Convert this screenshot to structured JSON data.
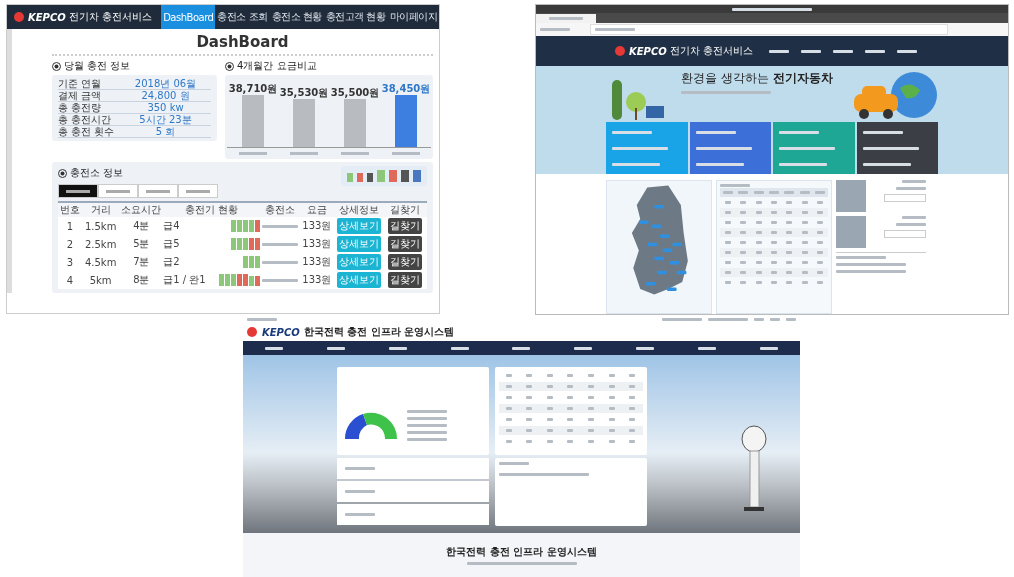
{
  "dashboard_screen": {
    "logo": "KEPCO",
    "service_name": "전기차 충전서비스",
    "nav": [
      {
        "label": "DashBoard",
        "selected": true
      },
      {
        "label": "충전소 조회",
        "selected": false
      },
      {
        "label": "충전소 현황",
        "selected": false
      },
      {
        "label": "충전고객 현황",
        "selected": false
      },
      {
        "label": "마이페이지",
        "selected": false
      }
    ],
    "title": "DashBoard",
    "monthly_info": {
      "title": "당월 충전 정보",
      "rows": [
        {
          "label": "기준 연월",
          "value": "2018년 06월"
        },
        {
          "label": "결제 금액",
          "value": "24,800 원"
        },
        {
          "label": "총 충전량",
          "value": "350 kw"
        },
        {
          "label": "총 충전시간",
          "value": "5시간 23분"
        },
        {
          "label": "총 충전 횟수",
          "value": "5 회"
        }
      ]
    },
    "fee_comparison": {
      "title": "4개월간 요금비교",
      "bars": [
        {
          "amount": "38,710원"
        },
        {
          "amount": "35,530원"
        },
        {
          "amount": "35,500원"
        },
        {
          "amount": "38,450원"
        }
      ]
    },
    "stations": {
      "title": "충전소 정보",
      "tabs": [
        {
          "selected": true
        },
        {
          "selected": false
        },
        {
          "selected": false
        },
        {
          "selected": false
        }
      ],
      "legend": [
        {
          "kind": "slow_available"
        },
        {
          "kind": "slow_in_use"
        },
        {
          "kind": "slow_offline"
        },
        {
          "kind": "fast_available"
        },
        {
          "kind": "fast_in_use"
        },
        {
          "kind": "fast_offline"
        },
        {
          "kind": "reserved"
        }
      ],
      "columns": [
        "번호",
        "거리",
        "소요시간",
        "충전기 현황",
        "충전소",
        "요금",
        "상세정보",
        "길찾기"
      ],
      "rows": [
        {
          "no": "1",
          "distance": "1.5km",
          "time": "4분",
          "summary": "급4",
          "chargers": [
            {
              "kind": "fast_available"
            },
            {
              "kind": "fast_available"
            },
            {
              "kind": "fast_available"
            },
            {
              "kind": "fast_available"
            },
            {
              "kind": "fast_in_use"
            }
          ],
          "price": "133원",
          "detail_button": "상세보기",
          "route_button": "길찾기"
        },
        {
          "no": "2",
          "distance": "2.5km",
          "time": "5분",
          "summary": "급5",
          "chargers": [
            {
              "kind": "fast_available"
            },
            {
              "kind": "fast_available"
            },
            {
              "kind": "fast_available"
            },
            {
              "kind": "fast_in_use"
            },
            {
              "kind": "fast_in_use"
            }
          ],
          "price": "133원",
          "detail_button": "상세보기",
          "route_button": "길찾기"
        },
        {
          "no": "3",
          "distance": "4.5km",
          "time": "7분",
          "summary": "급2",
          "chargers": [
            {
              "kind": "fast_available"
            },
            {
              "kind": "fast_available"
            },
            {
              "kind": "fast_available"
            }
          ],
          "price": "133원",
          "detail_button": "상세보기",
          "route_button": "길찾기"
        },
        {
          "no": "4",
          "distance": "5km",
          "time": "8분",
          "summary": "급1 / 완1",
          "chargers": [
            {
              "kind": "fast_available"
            },
            {
              "kind": "fast_available"
            },
            {
              "kind": "fast_available"
            },
            {
              "kind": "fast_in_use"
            },
            {
              "kind": "fast_in_use"
            },
            {
              "kind": "slow_available"
            },
            {
              "kind": "slow_in_use"
            }
          ],
          "price": "133원",
          "detail_button": "상세보기",
          "route_button": "길찾기"
        }
      ]
    }
  },
  "portal_screen": {
    "logo": "KEPCO",
    "service_name": "전기차 충전서비스",
    "banner_heading": "환경을 생각하는 **전기자동차**",
    "stat_cards": [
      {
        "kind": "count"
      },
      {
        "kind": "time"
      },
      {
        "kind": "usage"
      },
      {
        "kind": "search"
      }
    ]
  },
  "operations_screen": {
    "logo": "KEPCO",
    "system_name": "한국전력 충전 인프라 운영시스템",
    "footer_title": "한국전력 충전 인프라 운영시스템"
  }
}
